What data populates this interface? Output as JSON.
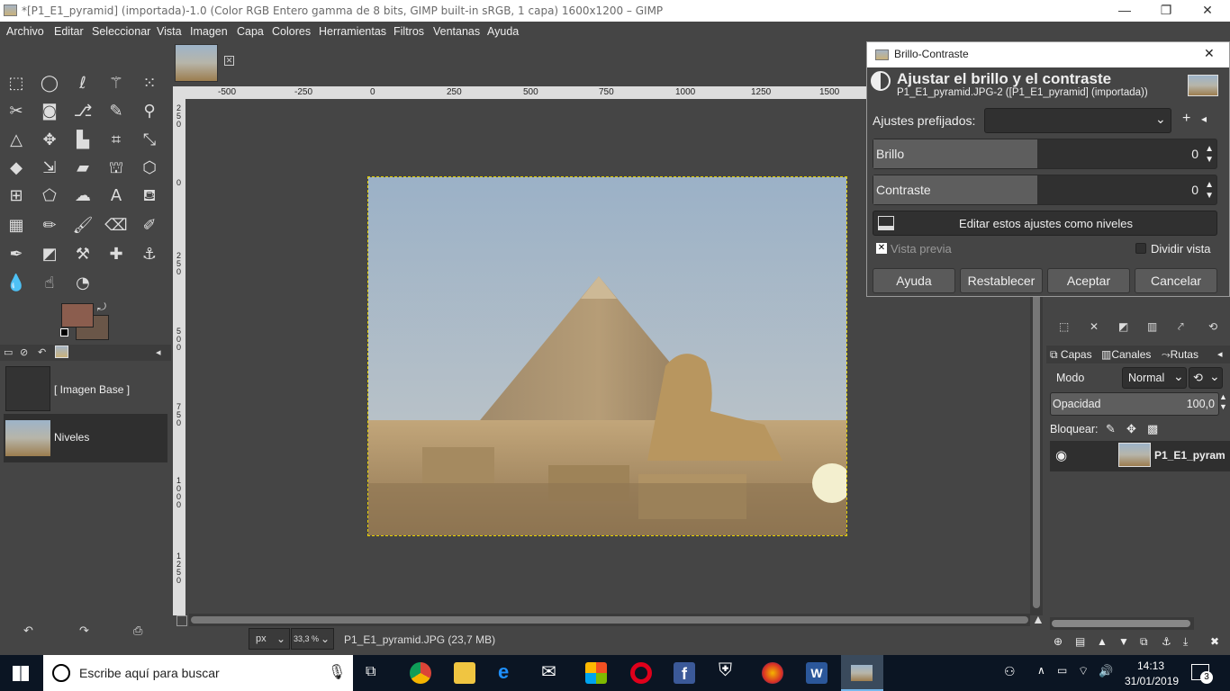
{
  "window": {
    "title": "*[P1_E1_pyramid] (importada)-1.0 (Color RGB Entero gamma de 8 bits, GIMP built-in sRGB, 1 capa) 1600x1200 – GIMP",
    "minimize": "—",
    "maximize": "❐",
    "close": "✕"
  },
  "menu": [
    "Archivo",
    "Editar",
    "Seleccionar",
    "Vista",
    "Imagen",
    "Capa",
    "Colores",
    "Herramientas",
    "Filtros",
    "Ventanas",
    "Ayuda"
  ],
  "colors": {
    "fg": "#8b5d4e",
    "bg": "#6a5648",
    "accent": "#0078d7"
  },
  "left_panel": {
    "items": [
      {
        "label": "[ Imagen Base ]"
      },
      {
        "label": "Niveles"
      }
    ]
  },
  "canvas": {
    "rulers_h": [
      "-500",
      "-250",
      "0",
      "250",
      "500",
      "750",
      "1000",
      "1250",
      "1500"
    ],
    "rulers_v": [
      "2 5 0",
      "0",
      "2 5 0",
      "5 0 0",
      "7 5 0",
      "1 0 0 0",
      "1 2 5 0"
    ],
    "unit": "px",
    "zoom": "33,3 %",
    "file_info": "P1_E1_pyramid.JPG (23,7 MB)"
  },
  "dialog": {
    "window_title": "Brillo-Contraste",
    "close": "✕",
    "heading": "Ajustar el brillo y el contraste",
    "subheading": "P1_E1_pyramid.JPG-2 ([P1_E1_pyramid] (importada))",
    "presets_label": "Ajustes prefijados:",
    "presets_value": "",
    "brightness_label": "Brillo",
    "brightness_value": "0",
    "contrast_label": "Contraste",
    "contrast_value": "0",
    "edit_levels": "Editar estos ajustes como niveles",
    "preview_label": "Vista previa",
    "preview_checked": true,
    "split_label": "Dividir vista",
    "split_checked": false,
    "buttons": {
      "help": "Ayuda",
      "reset": "Restablecer",
      "ok": "Aceptar",
      "cancel": "Cancelar"
    }
  },
  "layers_panel": {
    "tabs": {
      "layers": "Capas",
      "channels": "Canales",
      "paths": "Rutas"
    },
    "mode_label": "Modo",
    "mode_value": "Normal",
    "opacity_label": "Opacidad",
    "opacity_value": "100,0",
    "lock_label": "Bloquear:",
    "layer_name": "P1_E1_pyram"
  },
  "taskbar": {
    "search_placeholder": "Escribe aquí para buscar",
    "time": "14:13",
    "date": "31/01/2019",
    "notifications": "3"
  }
}
